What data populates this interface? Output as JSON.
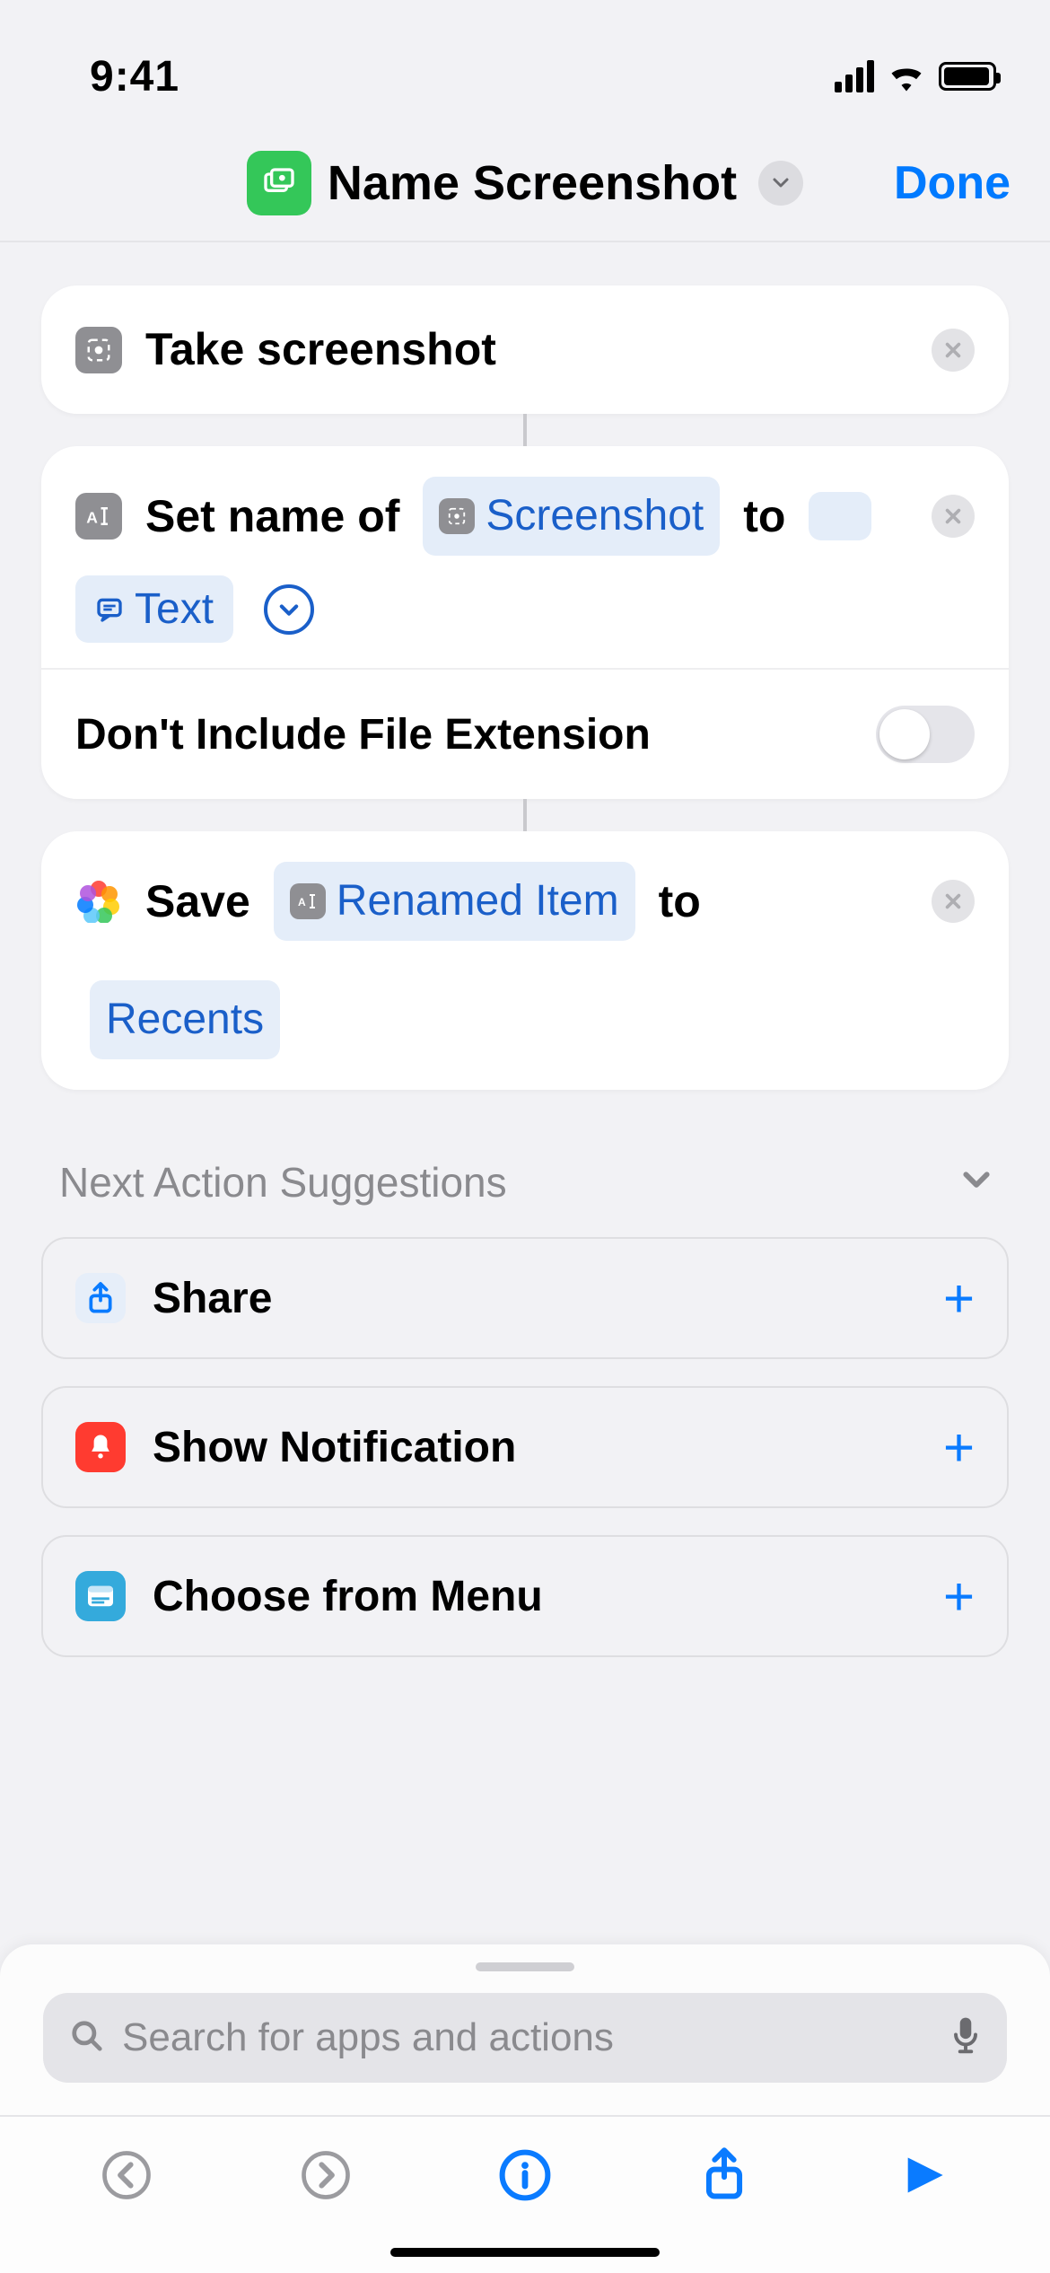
{
  "status": {
    "time": "9:41"
  },
  "nav": {
    "title": "Name Screenshot",
    "done": "Done"
  },
  "actions": {
    "take_screenshot": {
      "label": "Take screenshot"
    },
    "set_name": {
      "prefix": "Set name of",
      "variable": "Screenshot",
      "mid": "to",
      "text_pill": "Text",
      "option_label": "Don't Include File Extension",
      "option_on": false
    },
    "save": {
      "prefix": "Save",
      "variable": "Renamed Item",
      "mid": "to",
      "album": "Recents"
    }
  },
  "suggestions": {
    "title": "Next Action Suggestions",
    "items": [
      {
        "label": "Share",
        "icon": "share"
      },
      {
        "label": "Show Notification",
        "icon": "notification"
      },
      {
        "label": "Choose from Menu",
        "icon": "menu"
      }
    ]
  },
  "search": {
    "placeholder": "Search for apps and actions"
  }
}
